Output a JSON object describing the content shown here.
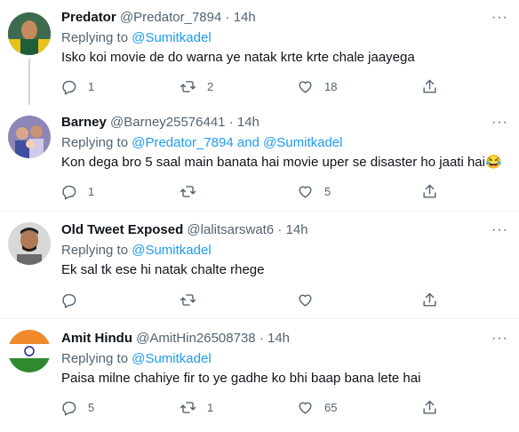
{
  "tweets": [
    {
      "name": "Predator",
      "handle": "@Predator_7894",
      "time": "14h",
      "replying_prefix": "Replying to",
      "replying_to": "@Sumitkadel",
      "text": "Isko koi movie de do warna ye natak krte krte chale jaayega",
      "replies": "1",
      "retweets": "2",
      "likes": "18"
    },
    {
      "name": "Barney",
      "handle": "@Barney25576441",
      "time": "14h",
      "replying_prefix": "Replying to",
      "replying_to": "@Predator_7894 and @Sumitkadel",
      "text": "Kon dega bro 5 saal main banata hai movie uper se disaster ho jaati hai😂",
      "replies": "1",
      "retweets": "",
      "likes": "5"
    },
    {
      "name": "Old Tweet Exposed",
      "handle": "@lalitsarswat6",
      "time": "14h",
      "replying_prefix": "Replying to",
      "replying_to": "@Sumitkadel",
      "text": "Ek sal tk ese hi natak chalte rhege",
      "replies": "",
      "retweets": "",
      "likes": ""
    },
    {
      "name": "Amit Hindu",
      "handle": "@AmitHin26508738",
      "time": "14h",
      "replying_prefix": "Replying to",
      "replying_to": "@Sumitkadel",
      "text": "Paisa milne chahiye fir to ye gadhe ko bhi baap bana lete hai",
      "replies": "5",
      "retweets": "1",
      "likes": "65"
    }
  ],
  "separator": "·",
  "more_glyph": "···",
  "icons": [
    "reply-icon",
    "retweet-icon",
    "like-icon",
    "share-icon",
    "more-icon"
  ],
  "colors": {
    "link": "#1d9bf0",
    "secondary": "#536471",
    "text": "#0f1419",
    "divider": "#eff3f4"
  }
}
